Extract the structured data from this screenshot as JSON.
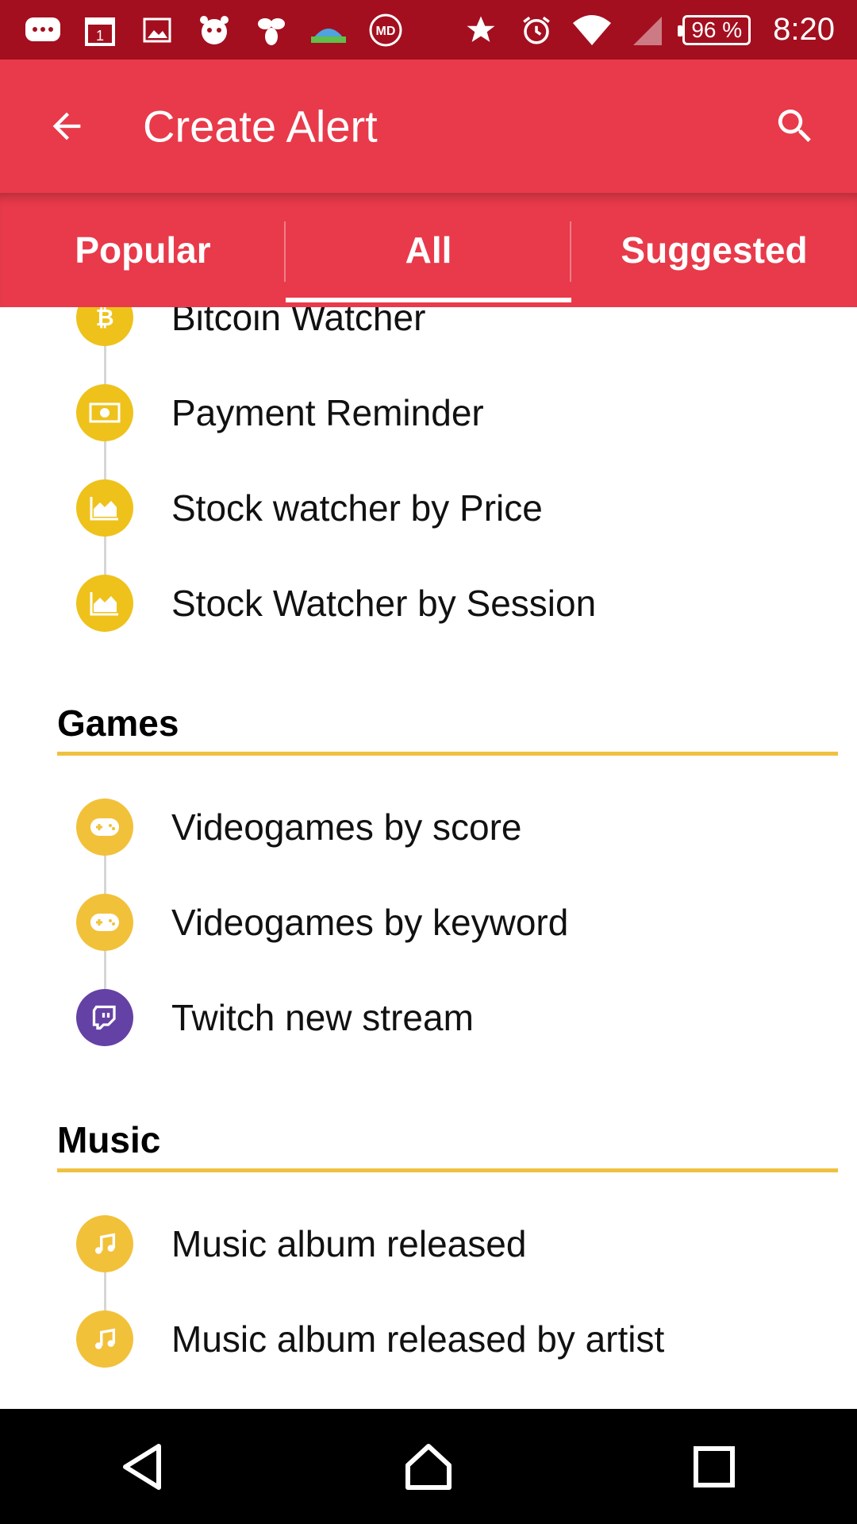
{
  "status_bar": {
    "battery": "96 %",
    "time": "8:20",
    "icons": [
      "messenger-icon",
      "calendar-icon",
      "gallery-icon",
      "alarm-app-icon",
      "bee-icon",
      "globe-app-icon",
      "md-app-icon",
      "star-icon",
      "alarm-clock-icon",
      "wifi-icon",
      "signal-icon"
    ]
  },
  "app_bar": {
    "title": "Create Alert"
  },
  "tabs": [
    {
      "label": "Popular",
      "active": false
    },
    {
      "label": "All",
      "active": true
    },
    {
      "label": "Suggested",
      "active": false
    }
  ],
  "finance_items": [
    {
      "label": "Bitcoin Watcher",
      "icon": "bitcoin-icon",
      "color": "#eec21b"
    },
    {
      "label": "Payment Reminder",
      "icon": "money-icon",
      "color": "#eec21b"
    },
    {
      "label": "Stock watcher by Price",
      "icon": "area-chart-icon",
      "color": "#eec21b"
    },
    {
      "label": "Stock Watcher by Session",
      "icon": "area-chart-icon",
      "color": "#eec21b"
    }
  ],
  "games": {
    "header": "Games",
    "items": [
      {
        "label": "Videogames by score",
        "icon": "gamepad-icon",
        "color": "#f2c13a"
      },
      {
        "label": "Videogames by keyword",
        "icon": "gamepad-icon",
        "color": "#f2c13a"
      },
      {
        "label": "Twitch new stream",
        "icon": "twitch-icon",
        "color": "#6441a5"
      }
    ]
  },
  "music": {
    "header": "Music",
    "items": [
      {
        "label": "Music album released",
        "icon": "music-note-icon",
        "color": "#f2c13a"
      },
      {
        "label": "Music album released by artist",
        "icon": "music-note-icon",
        "color": "#f2c13a"
      }
    ]
  },
  "colors": {
    "status_bar": "#a30f1f",
    "app_bar": "#e83a4a",
    "section_rule": "#f0c040"
  }
}
